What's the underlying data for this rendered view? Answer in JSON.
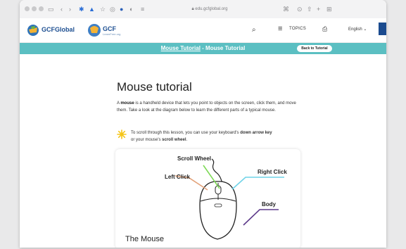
{
  "browser": {
    "url": "edu.gcfglobal.org"
  },
  "header": {
    "logo_text": "GCFGlobal",
    "logo2_text": "GCF",
    "logo2_sub": "LearnFree.org",
    "topics_label": "TOPICS",
    "language_label": "English"
  },
  "breadcrumb": {
    "link_label": "Mouse Tutorial",
    "separator": " - ",
    "current_label": "Mouse Tutorial",
    "back_button": "Back to Tutorial"
  },
  "article": {
    "title": "Mouse tutorial",
    "para_prefix": "A ",
    "para_bold": "mouse",
    "para_rest": " is a handheld device that lets you point to objects on the screen, click them, and move them. Take a look at the diagram below to learn the different parts of a typical mouse.",
    "tip_line1_prefix": "To scroll through this lesson, you can use your keyboard's ",
    "tip_line1_bold": "down arrow key",
    "tip_line2_prefix": "or your mouse's ",
    "tip_line2_bold": "scroll wheel",
    "tip_line2_suffix": "."
  },
  "diagram": {
    "scroll_wheel": "Scroll Wheel",
    "left_click": "Left Click",
    "right_click": "Right Click",
    "body": "Body",
    "caption": "The Mouse",
    "colors": {
      "scroll_wheel": "#7ed957",
      "left_click": "#e3a27a",
      "right_click": "#6fd3e8",
      "body": "#5d3a8a"
    }
  }
}
